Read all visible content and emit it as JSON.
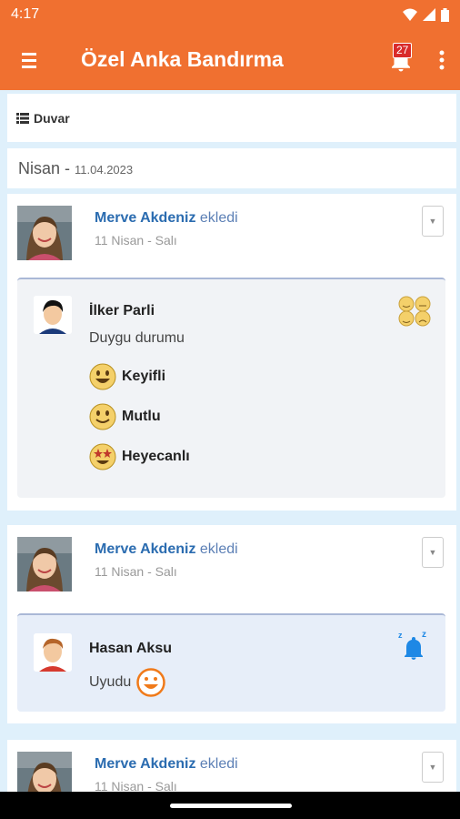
{
  "status": {
    "time": "4:17"
  },
  "appbar": {
    "title": "Özel Anka Bandırma",
    "notification_count": "27"
  },
  "wall": {
    "label": "Duvar"
  },
  "date_header": {
    "month": "Nisan -",
    "date": "11.04.2023"
  },
  "posts": [
    {
      "author": "Merve Akdeniz",
      "action": "ekledi",
      "date": "11 Nisan - Salı",
      "child": "İlker Parli",
      "subtitle": "Duygu durumu",
      "moods": [
        {
          "label": "Keyifli",
          "icon": "grinning-face-icon"
        },
        {
          "label": "Mutlu",
          "icon": "smiling-face-icon"
        },
        {
          "label": "Heyecanlı",
          "icon": "star-struck-face-icon"
        }
      ]
    },
    {
      "author": "Merve Akdeniz",
      "action": "ekledi",
      "date": "11 Nisan - Salı",
      "child": "Hasan Aksu",
      "status_text": "Uyudu",
      "status_icon": "sleep-bell-icon"
    },
    {
      "author": "Merve Akdeniz",
      "action": "ekledi",
      "date": "11 Nisan - Salı"
    }
  ],
  "colors": {
    "brand": "#f07030",
    "link": "#2b6cb0",
    "bell": "#1e88e5"
  }
}
